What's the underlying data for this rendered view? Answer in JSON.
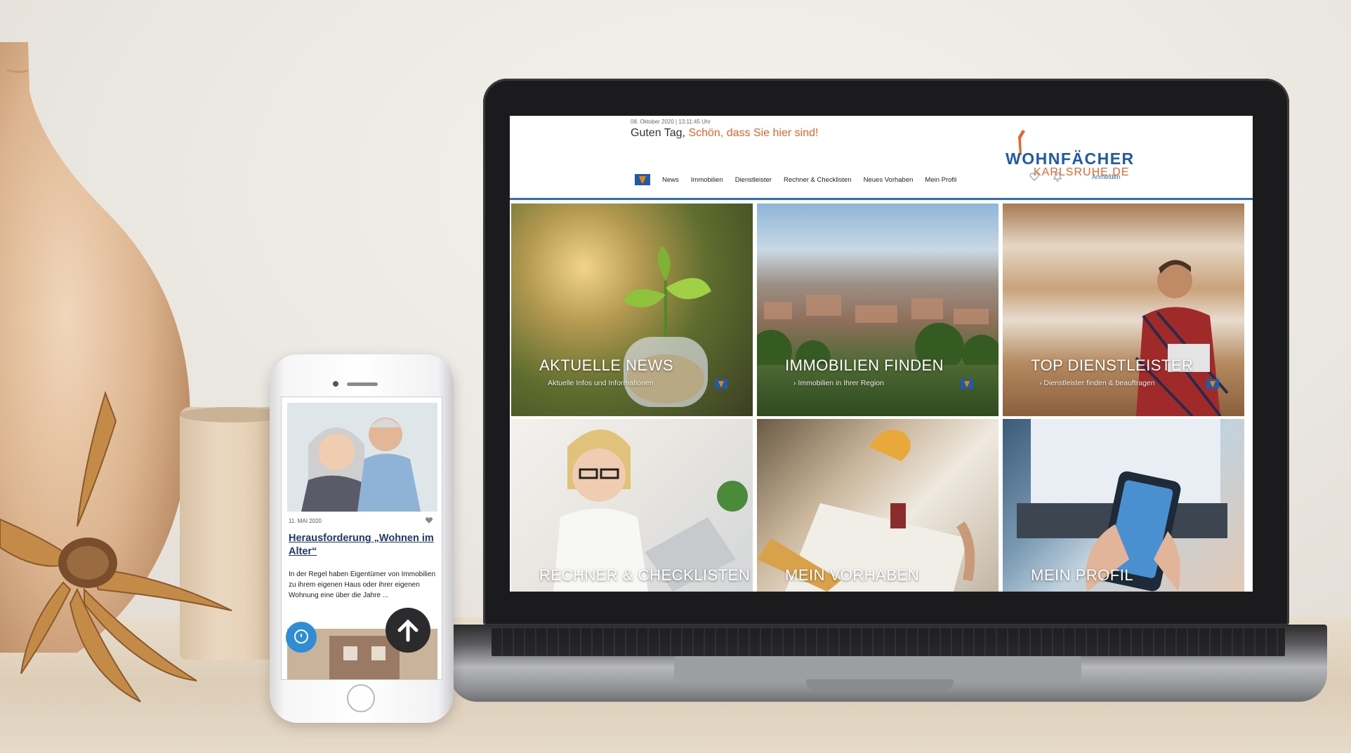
{
  "website": {
    "date_line": "08. Oktober 2020 | 13:11:45 Uhr",
    "greeting_prefix": "Guten Tag,",
    "greeting_accent": "Schön, dass Sie hier sind!",
    "logo_line1": "WOHNFÄCHER",
    "logo_line2": "KARLSRUHE.DE",
    "nav": [
      "News",
      "Immobilien",
      "Dienstleister",
      "Rechner & Checklisten",
      "Neues Vorhaben",
      "Mein Profil"
    ],
    "login": "Anmelden",
    "tiles": [
      {
        "title": "AKTUELLE NEWS",
        "subtitle": "Aktuelle Infos und Informationen"
      },
      {
        "title": "IMMOBILIEN FINDEN",
        "subtitle": "› Immobilien in Ihrer Region"
      },
      {
        "title": "TOP DIENSTLEISTER",
        "subtitle": "› Dienstleister finden & beauftragen"
      },
      {
        "title": "RECHNER & CHECKLISTEN",
        "subtitle": ""
      },
      {
        "title": "MEIN VORHABEN",
        "subtitle": ""
      },
      {
        "title": "MEIN PROFIL",
        "subtitle": ""
      }
    ]
  },
  "phone": {
    "date": "11. MAI 2020",
    "title": "Herausforderung „Wohnen im Alter“",
    "body": "In der Regel haben Eigentümer von Immobilien zu ihrem eigenen Haus oder ihrer eigenen Wohnung eine über die Jahre ..."
  },
  "colors": {
    "brand_blue": "#1f5ba8",
    "brand_orange": "#e8652a"
  }
}
